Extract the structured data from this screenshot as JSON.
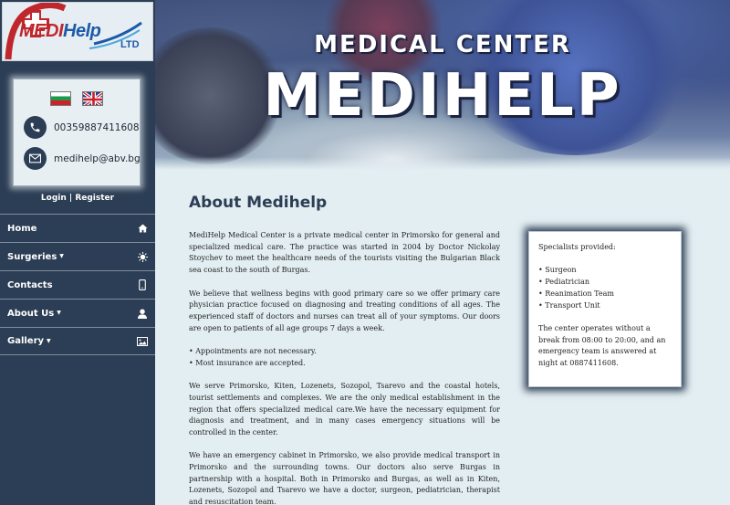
{
  "logo": {
    "medi": "MEDI",
    "help": "Help",
    "ltd": "LTD"
  },
  "contact": {
    "phone": "00359887411608",
    "email": "medihelp@abv.bg"
  },
  "auth": {
    "login": "Login",
    "separator": " | ",
    "register": "Register"
  },
  "nav": {
    "home": "Home",
    "surgeries": "Surgeries",
    "contacts": "Contacts",
    "about": "About Us",
    "gallery": "Gallery"
  },
  "banner": {
    "subtitle": "MEDICAL CENTER",
    "title": "MEDIHELP"
  },
  "page": {
    "title": "About Medihelp",
    "paragraphs": [
      "MediHelp Medical Center is a private medical center in Primorsko for general and specialized medical care. The practice was started in 2004 by Doctor Nickolay Stoychev to meet the healthcare needs of the tourists visiting the Bulgarian Black sea coast to the south of Burgas.",
      "We believe that wellness begins with good primary care so we offer primary care physician practice focused on diagnosing and treating conditions of all ages. The experienced staff of doctors and nurses can treat all of your symptoms. Our doors are open to patients of all age groups 7 days a week.",
      "We serve Primorsko, Kiten, Lozenets, Sozopol, Tsarevo and the coastal hotels, tourist settlements and complexes. We are the only medical establishment in the region that offers specialized medical care.We have the necessary equipment for diagnosis and treatment, and in many cases emergency situations will be controlled in the center.",
      "We have an emergency cabinet in Primorsko, we also provide medical transport in Primorsko and the surrounding towns. Our doctors also serve Burgas in partnership with a hospital. Both in Primorsko and Burgas, as well as in Kiten, Lozenets, Sozopol and Tsarevo we have a doctor, surgeon, pediatrician, therapist and resuscitation team."
    ],
    "bullets": [
      "• Appointments are not necessary.",
      "• Most insurance are accepted."
    ]
  },
  "aside": {
    "heading": "Specialists provided:",
    "items": [
      "• Surgeon",
      "• Pediatrician",
      "• Reanimation Team",
      "• Transport Unit"
    ],
    "note": "The center operates without a break from 08:00 to 20:00, and an emergency team is answered at night at 0887411608."
  },
  "colors": {
    "sidebar": "#2c3e55",
    "page_background": "#e3eef2",
    "title": "#2c3e55",
    "logo_red": "#c0272d",
    "logo_blue": "#1d5aa8"
  }
}
